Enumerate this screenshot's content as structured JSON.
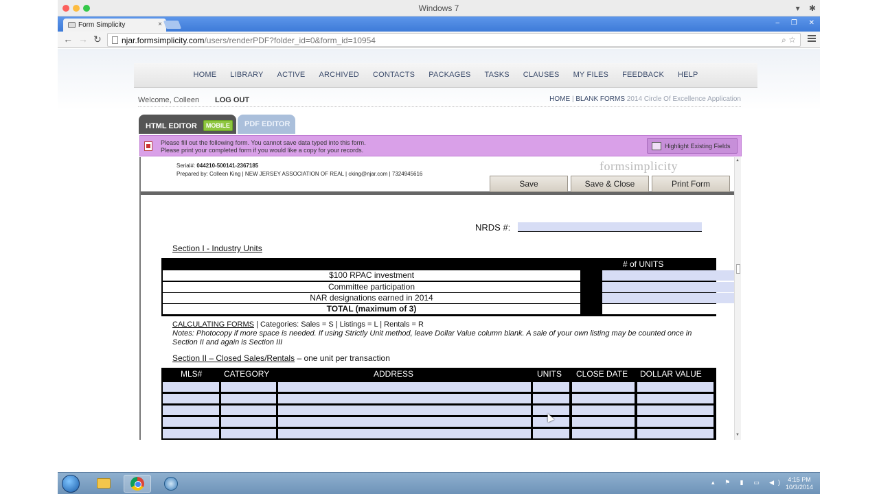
{
  "window": {
    "title": "Windows 7"
  },
  "browser": {
    "tab_title": "Form Simplicity",
    "url_host": "njar.formsimplicity.com",
    "url_path": "/users/renderPDF?folder_id=0&form_id=10954"
  },
  "nav": {
    "items": [
      "HOME",
      "LIBRARY",
      "ACTIVE",
      "ARCHIVED",
      "CONTACTS",
      "PACKAGES",
      "TASKS",
      "CLAUSES",
      "MY FILES",
      "FEEDBACK",
      "HELP"
    ]
  },
  "user": {
    "welcome": "Welcome, Colleen",
    "logout": "LOG OUT"
  },
  "breadcrumb": {
    "home": "HOME",
    "sep": "|",
    "blank_forms": "BLANK FORMS",
    "current": "2014 Circle Of Excellence Application"
  },
  "editor_tabs": {
    "html": "HTML EDITOR",
    "mobile": "MOBILE",
    "pdf": "PDF EDITOR"
  },
  "notice": {
    "line1": "Please fill out the following form. You cannot save data typed into this form.",
    "line2": "Please print your completed form if you would like a copy for your records.",
    "highlight_button": "Highlight Existing Fields"
  },
  "form": {
    "serial_label": "Serial#:",
    "serial_value": "044210-500141-2367185",
    "prepared": "Prepared by: Colleen King  |  NEW JERSEY ASSOCIATION OF REAL  |  cking@njar.com  |  7324945616",
    "logo": "formsimplicity",
    "buttons": {
      "save": "Save",
      "save_close": "Save & Close",
      "print": "Print Form"
    },
    "nrds_label": "NRDS #:",
    "section1_title": "Section I - Industry Units",
    "units_header": "# of UNITS",
    "units_rows": [
      "$100 RPAC investment",
      "Committee participation",
      "NAR designations earned in 2014",
      "TOTAL (maximum of 3)"
    ],
    "calc_link": "CALCULATING FORMS",
    "calc_rest": " | Categories: Sales = S | Listings = L | Rentals = R",
    "notes": "Notes: Photocopy if more space is needed. If using Strictly Unit method, leave Dollar Value column blank. A sale of your own listing may be counted once in Section II and again is Section III",
    "section2_title": "Section II – Closed Sales/Rentals",
    "section2_suffix": " – one unit per transaction",
    "sales_columns": [
      "MLS#",
      "CATEGORY",
      "ADDRESS",
      "UNITS",
      "CLOSE DATE",
      "DOLLAR VALUE"
    ]
  },
  "taskbar": {
    "time": "4:15 PM",
    "date": "10/3/2014"
  },
  "colors": {
    "accent_nav": "#3a4a6a",
    "notice_bg": "#d9a0e8",
    "field_fill": "#d7ddf5",
    "pdf_tab": "#aabfdb",
    "mobile_badge": "#8ec63f"
  }
}
